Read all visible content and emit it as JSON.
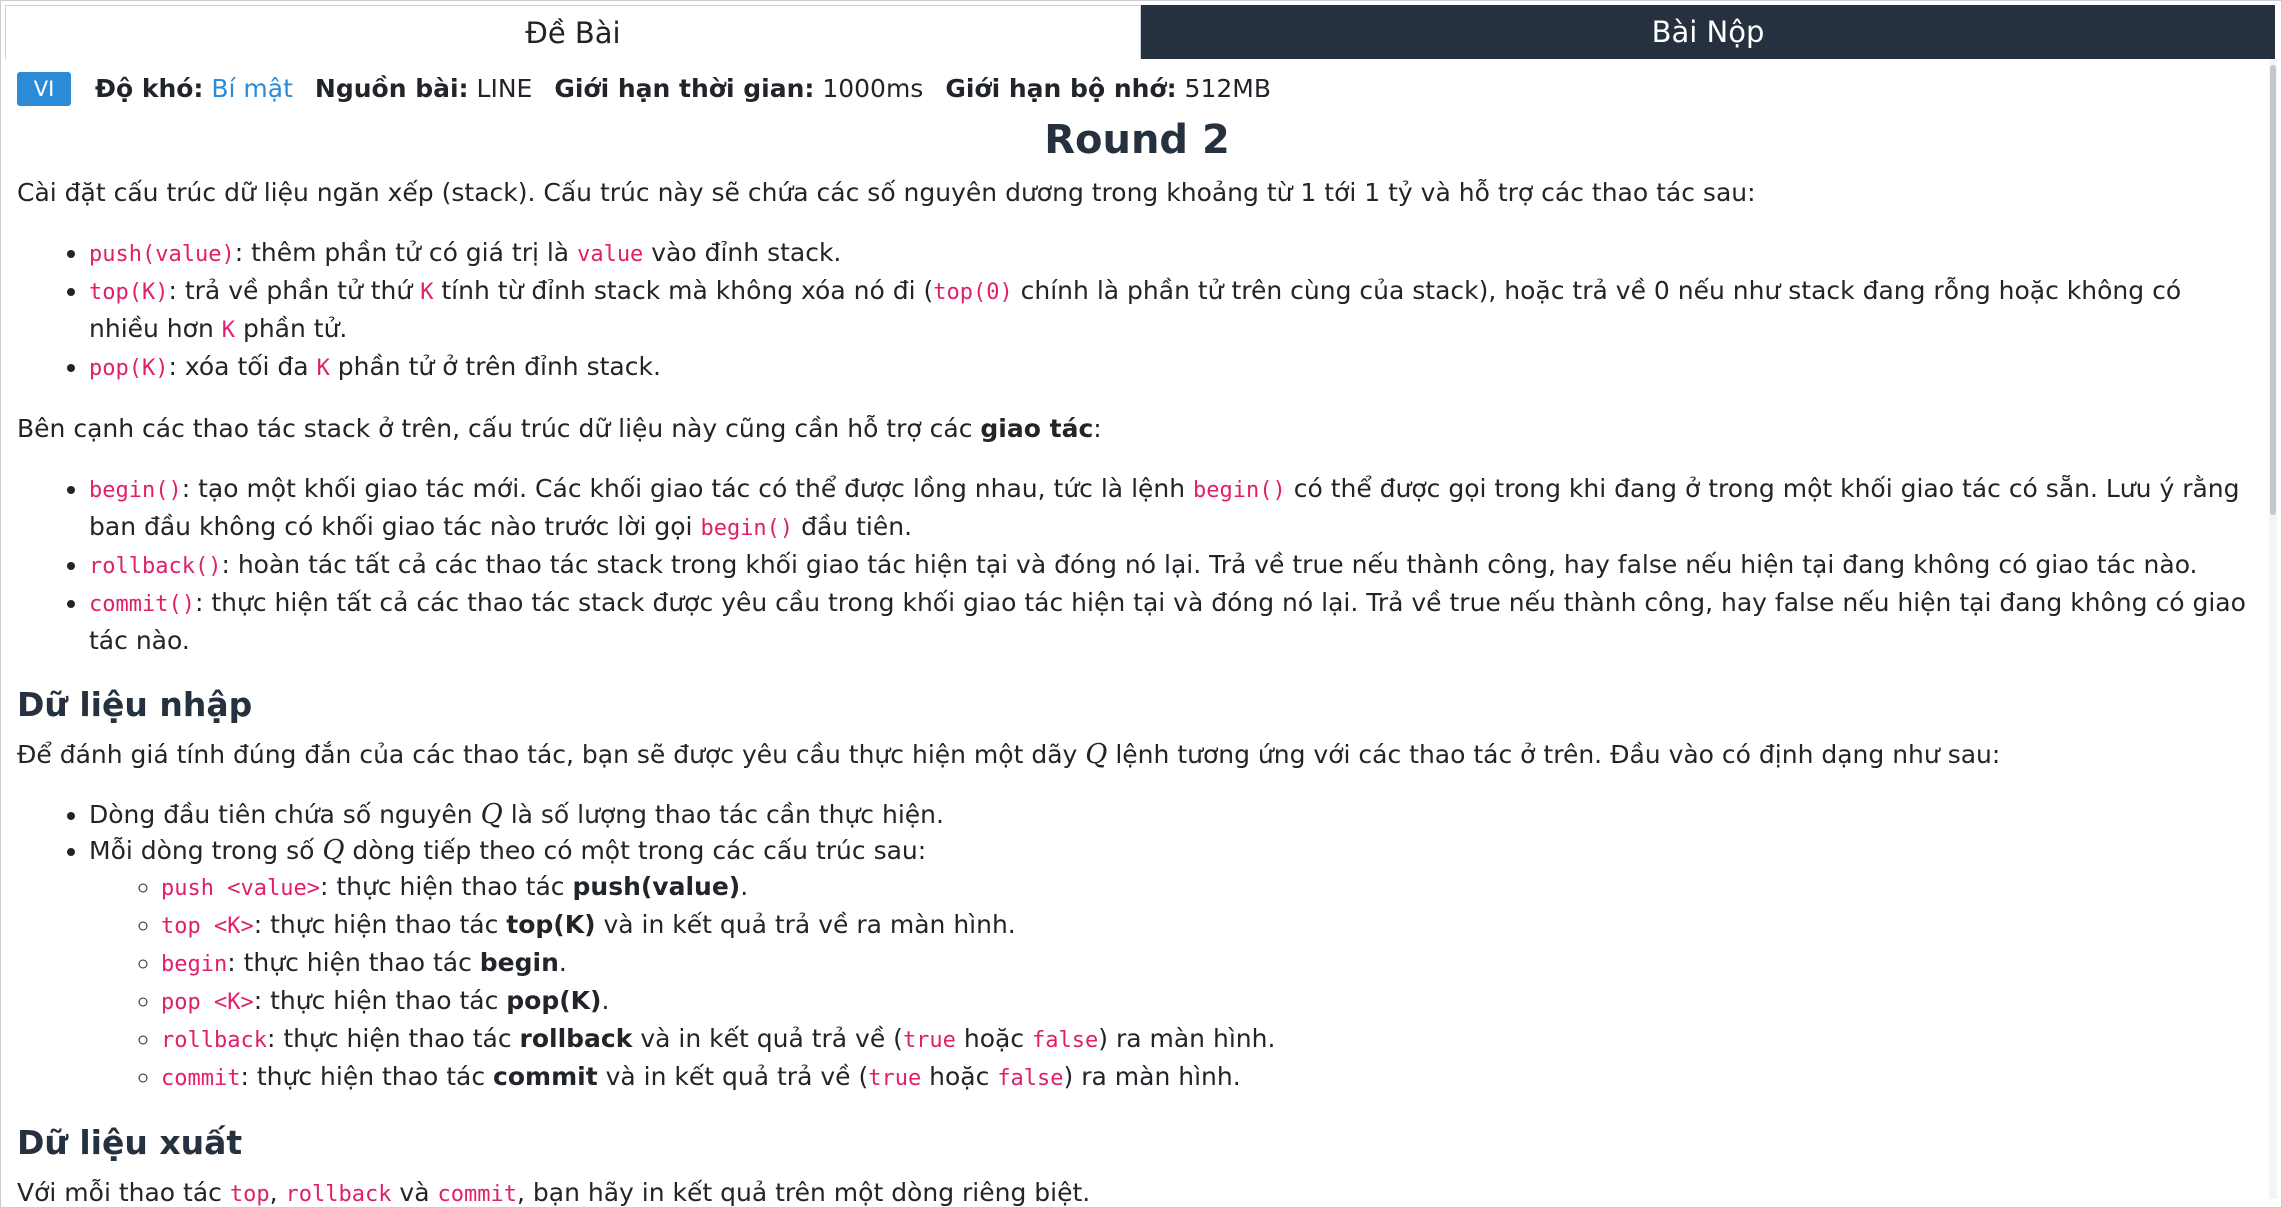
{
  "tabs": [
    {
      "label": "Đề Bài",
      "active": true
    },
    {
      "label": "Bài Nộp",
      "active": false
    }
  ],
  "meta": {
    "lang": "VI",
    "difficulty_label": "Độ khó:",
    "difficulty_value": "Bí mật",
    "source_label": "Nguồn bài:",
    "source_value": "LINE",
    "time_label": "Giới hạn thời gian:",
    "time_value": "1000ms",
    "memory_label": "Giới hạn bộ nhớ:",
    "memory_value": "512MB"
  },
  "title": "Round 2",
  "intro": "Cài đặt cấu trúc dữ liệu ngăn xếp (stack). Cấu trúc này sẽ chứa các số nguyên dương trong khoảng từ 1 tới 1 tỷ và hỗ trợ các thao tác sau:",
  "stack_ops": {
    "push_code": "push(value)",
    "push_t1": ": thêm phần tử có giá trị là ",
    "push_c2": "value",
    "push_t2": " vào đỉnh stack.",
    "top_code": "top(K)",
    "top_t1": ": trả về phần tử thứ ",
    "top_c2": "K",
    "top_t2": " tính từ đỉnh stack mà không xóa nó đi (",
    "top_c3": "top(0)",
    "top_t3": " chính là phần tử trên cùng của stack), hoặc trả về 0 nếu như stack đang rỗng hoặc không có nhiều hơn ",
    "top_c4": "K",
    "top_t4": " phần tử.",
    "pop_code": "pop(K)",
    "pop_t1": ": xóa tối đa ",
    "pop_c2": "K",
    "pop_t2": " phần tử ở trên đỉnh stack."
  },
  "txn_intro_t1": "Bên cạnh các thao tác stack ở trên, cấu trúc dữ liệu này cũng cần hỗ trợ các ",
  "txn_intro_b": "giao tác",
  "txn_intro_t2": ":",
  "txn_ops": {
    "begin_code": "begin()",
    "begin_t1": ": tạo một khối giao tác mới. Các khối giao tác có thể được lồng nhau, tức là lệnh ",
    "begin_c2": "begin()",
    "begin_t2": " có thể được gọi trong khi đang ở trong một khối giao tác có sẵn. Lưu ý rằng ban đầu không có khối giao tác nào trước lời gọi ",
    "begin_c3": "begin()",
    "begin_t3": " đầu tiên.",
    "rollback_code": "rollback()",
    "rollback_t1": ": hoàn tác tất cả các thao tác stack trong khối giao tác hiện tại và đóng nó lại. Trả về true nếu thành công, hay false nếu hiện tại đang không có giao tác nào.",
    "commit_code": "commit()",
    "commit_t1": ": thực hiện tất cả các thao tác stack được yêu cầu trong khối giao tác hiện tại và đóng nó lại. Trả về true nếu thành công, hay false nếu hiện tại đang không có giao tác nào."
  },
  "input_section": {
    "heading": "Dữ liệu nhập",
    "intro_t1": "Để đánh giá tính đúng đắn của các thao tác, bạn sẽ được yêu cầu thực hiện một dãy ",
    "intro_var": "Q",
    "intro_t2": " lệnh tương ứng với các thao tác ở trên. Đầu vào có định dạng như sau:",
    "li1_t1": "Dòng đầu tiên chứa số nguyên ",
    "li1_var": "Q",
    "li1_t2": " là số lượng thao tác cần thực hiện.",
    "li2_t1": "Mỗi dòng trong số ",
    "li2_var": "Q",
    "li2_t2": " dòng tiếp theo có một trong các cấu trúc sau:",
    "sub": {
      "push_code": "push <value>",
      "push_t1": ": thực hiện thao tác ",
      "push_b": "push(value)",
      "push_t2": ".",
      "top_code": "top <K>",
      "top_t1": ": thực hiện thao tác ",
      "top_b": "top(K)",
      "top_t2": " và in kết quả trả về ra màn hình.",
      "begin_code": "begin",
      "begin_t1": ": thực hiện thao tác ",
      "begin_b": "begin",
      "begin_t2": ".",
      "pop_code": "pop <K>",
      "pop_t1": ": thực hiện thao tác ",
      "pop_b": "pop(K)",
      "pop_t2": ".",
      "rollback_code": "rollback",
      "rollback_t1": ": thực hiện thao tác ",
      "rollback_b": "rollback",
      "rollback_t2": " và in kết quả trả về (",
      "rollback_c2": "true",
      "rollback_t3": " hoặc ",
      "rollback_c3": "false",
      "rollback_t4": ") ra màn hình.",
      "commit_code": "commit",
      "commit_t1": ": thực hiện thao tác ",
      "commit_b": "commit",
      "commit_t2": " và in kết quả trả về (",
      "commit_c2": "true",
      "commit_t3": " hoặc ",
      "commit_c3": "false",
      "commit_t4": ") ra màn hình."
    }
  },
  "output_section": {
    "heading": "Dữ liệu xuất",
    "t1": "Với mỗi thao tác ",
    "c1": "top",
    "t2": ", ",
    "c2": "rollback",
    "t3": " và ",
    "c3": "commit",
    "t4": ", bạn hãy in kết quả trên một dòng riêng biệt."
  }
}
